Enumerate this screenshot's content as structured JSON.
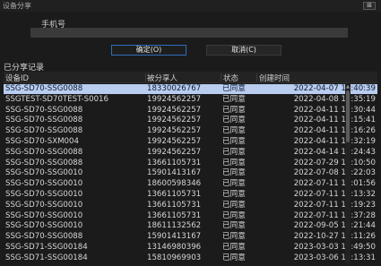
{
  "window": {
    "title": "设备分享",
    "close_glyph": "⊠"
  },
  "form": {
    "phone_label": "手机号",
    "phone_value": "",
    "phone_placeholder": ""
  },
  "buttons": {
    "ok_label": "确定(O)",
    "cancel_label": "取消(C)"
  },
  "records": {
    "title": "已分享记录",
    "headers": [
      "设备ID",
      "被分享人",
      "状态",
      "创建时间"
    ],
    "rows": [
      {
        "device_id": "SSG-SD70-SSG0088",
        "sharee": "18330026767",
        "status": "已同意",
        "created": "2022-04-07 15:40:39",
        "selected": true
      },
      {
        "device_id": "SSGTEST-SD70TEST-S0016",
        "sharee": "19924562257",
        "status": "已同意",
        "created": "2022-04-08 13:35:19"
      },
      {
        "device_id": "SSG-SD70-SSG0088",
        "sharee": "19924562257",
        "status": "已同意",
        "created": "2022-04-11 11:30:44"
      },
      {
        "device_id": "SSG-SD70-SSG0088",
        "sharee": "19924562257",
        "status": "已同意",
        "created": "2022-04-11 13:15:41"
      },
      {
        "device_id": "SSG-SD70-SSG0088",
        "sharee": "19924562257",
        "status": "已同意",
        "created": "2022-04-11 17:16:26"
      },
      {
        "device_id": "SSG-SD70-SXM004",
        "sharee": "19924562257",
        "status": "已同意",
        "created": "2022-04-11 17:32:19"
      },
      {
        "device_id": "SSG-SD70-SSG0088",
        "sharee": "19924562257",
        "status": "已同意",
        "created": "2022-04-14 10:24:43"
      },
      {
        "device_id": "SSG-SD70-SSG0088",
        "sharee": "13661105731",
        "status": "已同意",
        "created": "2022-07-29 15:10:50"
      },
      {
        "device_id": "SSG-SD70-SSG0010",
        "sharee": "15901413167",
        "status": "已同意",
        "created": "2022-07-08 16:22:03"
      },
      {
        "device_id": "SSG-SD70-SSG0010",
        "sharee": "18600598346",
        "status": "已同意",
        "created": "2022-07-11 10:01:56"
      },
      {
        "device_id": "SSG-SD70-SSG0010",
        "sharee": "13661105731",
        "status": "已同意",
        "created": "2022-07-11 11:13:32"
      },
      {
        "device_id": "SSG-SD70-SSG0010",
        "sharee": "13661105731",
        "status": "已同意",
        "created": "2022-07-11 11:19:23"
      },
      {
        "device_id": "SSG-SD70-SSG0010",
        "sharee": "13661105731",
        "status": "已同意",
        "created": "2022-07-11 11:37:28"
      },
      {
        "device_id": "SSG-SD70-SSG0010",
        "sharee": "18611132562",
        "status": "已同意",
        "created": "2022-09-05 15:21:44"
      },
      {
        "device_id": "SSG-SD70-SSG0088",
        "sharee": "15901413167",
        "status": "已同意",
        "created": "2022-10-27 10:11:26"
      },
      {
        "device_id": "SSG-SD71-SSG00184",
        "sharee": "13146980396",
        "status": "已同意",
        "created": "2023-03-03 17:49:50"
      },
      {
        "device_id": "SSG-SD71-SSG00184",
        "sharee": "15810969903",
        "status": "已同意",
        "created": "2023-03-06 14:13:31"
      }
    ]
  },
  "colors": {
    "selected_row": "#b8cdef",
    "ok_border": "#2f6fbd",
    "background": "#1b1b1b"
  }
}
